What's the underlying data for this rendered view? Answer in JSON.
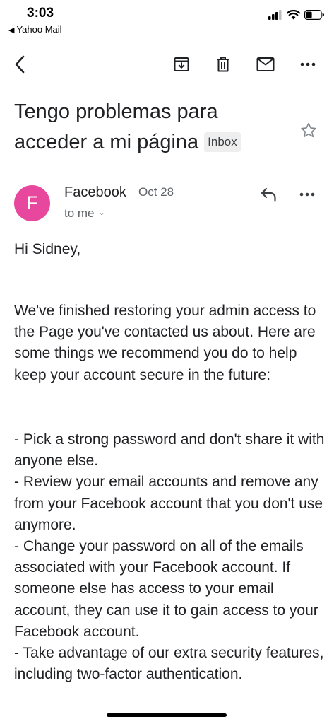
{
  "status_bar": {
    "time": "3:03",
    "back_app": "Yahoo Mail"
  },
  "email": {
    "subject": "Tengo problemas para acceder a mi página",
    "label": "Inbox",
    "sender": {
      "initial": "F",
      "name": "Facebook",
      "date": "Oct 28",
      "to": "to me"
    },
    "greeting": "Hi Sidney,",
    "paragraph1": "We've finished restoring your admin access to the Page you've contacted us about. Here are some things we recommend you do to help keep your account secure in the future:",
    "bullets": [
      "- Pick a strong password and don't share it with anyone else.",
      "- Review your email accounts and remove any from your Facebook account that you don't use anymore.",
      "- Change your password on all of the emails associated with your Facebook account. If someone else has access to your email account, they can use it to gain access to your Facebook account.",
      "- Take advantage of our extra security features, including two-factor authentication."
    ]
  },
  "icons": {
    "back": "chevron-left-icon",
    "archive": "archive-icon",
    "delete": "trash-icon",
    "mark_unread": "mail-icon",
    "more": "more-horizontal-icon",
    "star": "star-outline-icon",
    "reply": "reply-icon"
  },
  "colors": {
    "avatar": "#e8479e",
    "text": "#202124",
    "secondary": "#5f6368",
    "badge_bg": "#eeeeee"
  }
}
